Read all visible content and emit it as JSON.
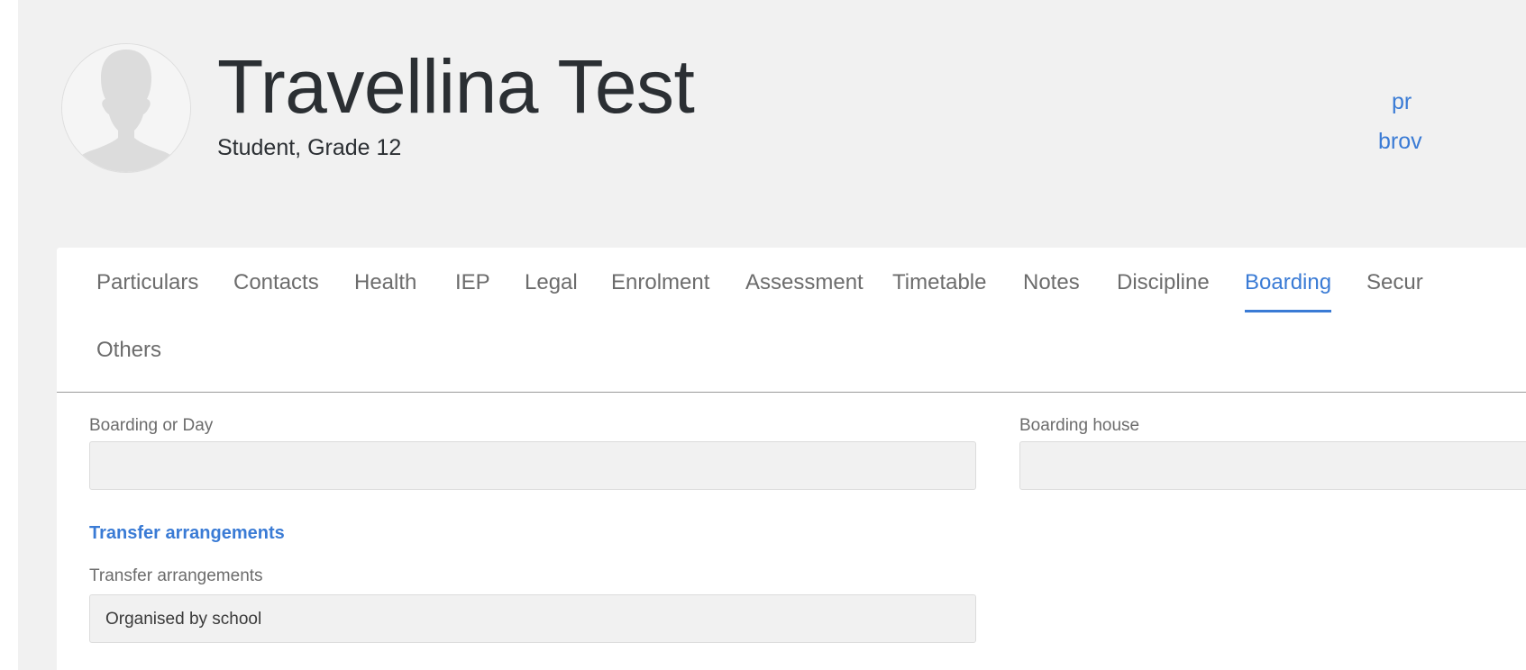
{
  "profile": {
    "name": "Travellina Test",
    "subtitle": "Student, Grade 12"
  },
  "side_links": [
    "pr",
    "brov"
  ],
  "tabs": [
    {
      "label": "Particulars"
    },
    {
      "label": "Contacts"
    },
    {
      "label": "Health"
    },
    {
      "label": "IEP"
    },
    {
      "label": "Legal"
    },
    {
      "label": "Enrolment"
    },
    {
      "label": "Assessment"
    },
    {
      "label": "Timetable"
    },
    {
      "label": "Notes"
    },
    {
      "label": "Discipline"
    },
    {
      "label": "Boarding"
    },
    {
      "label": "Secur"
    },
    {
      "label": "Others"
    }
  ],
  "active_tab": "Boarding",
  "form": {
    "boarding_or_day": {
      "label": "Boarding or Day",
      "value": ""
    },
    "boarding_house": {
      "label": "Boarding house",
      "value": ""
    },
    "transfer_section_title": "Transfer arrangements",
    "transfer": {
      "label": "Transfer arrangements",
      "value": "Organised by school"
    }
  },
  "colors": {
    "accent": "#3a7bd5",
    "page_bg": "#f1f1f1",
    "card_bg": "#ffffff",
    "muted_text": "#6c6c6c",
    "heading_text": "#2b2f33"
  },
  "icons": {
    "avatar": "user-silhouette-icon"
  }
}
